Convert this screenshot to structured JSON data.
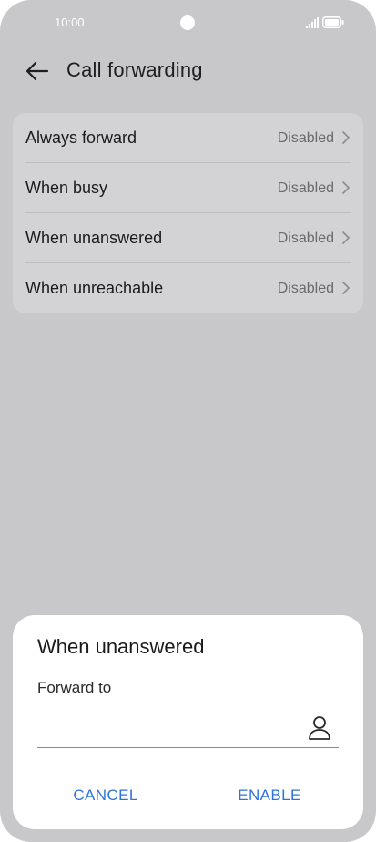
{
  "status_bar": {
    "time": "10:00"
  },
  "header": {
    "title": "Call forwarding",
    "back_icon": "arrow-left-icon"
  },
  "forwarding_options": [
    {
      "label": "Always forward",
      "value": "Disabled"
    },
    {
      "label": "When busy",
      "value": "Disabled"
    },
    {
      "label": "When unanswered",
      "value": "Disabled"
    },
    {
      "label": "When unreachable",
      "value": "Disabled"
    }
  ],
  "dialog": {
    "title": "When unanswered",
    "field_label": "Forward to",
    "field_value": "",
    "contact_icon": "person-icon",
    "cancel_label": "CANCEL",
    "enable_label": "ENABLE"
  },
  "colors": {
    "background": "#c8c8ca",
    "card": "#d3d3d5",
    "dialog": "#ffffff",
    "accent": "#2e74d6"
  }
}
